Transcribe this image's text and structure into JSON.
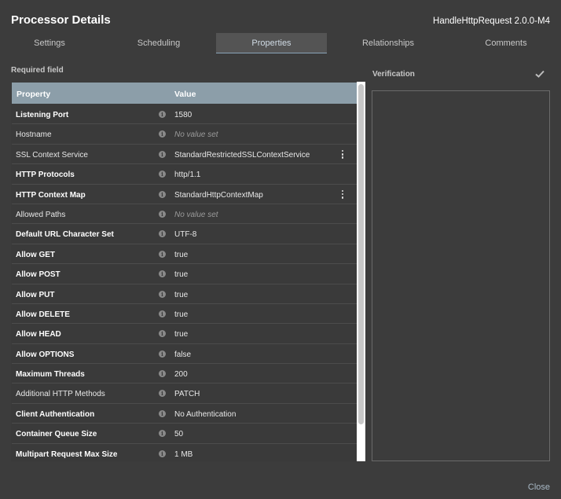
{
  "dialog": {
    "title": "Processor Details",
    "component_name": "HandleHttpRequest 2.0.0-M4",
    "close_label": "Close"
  },
  "tabs": [
    {
      "label": "Settings",
      "active": false
    },
    {
      "label": "Scheduling",
      "active": false
    },
    {
      "label": "Properties",
      "active": true
    },
    {
      "label": "Relationships",
      "active": false
    },
    {
      "label": "Comments",
      "active": false
    }
  ],
  "properties": {
    "required_label": "Required field",
    "header": {
      "property": "Property",
      "value": "Value"
    },
    "rows": [
      {
        "name": "Listening Port",
        "value": "1580",
        "required": true,
        "empty": false,
        "menu": false
      },
      {
        "name": "Hostname",
        "value": "No value set",
        "required": false,
        "empty": true,
        "menu": false
      },
      {
        "name": "SSL Context Service",
        "value": "StandardRestrictedSSLContextService",
        "required": false,
        "empty": false,
        "menu": true
      },
      {
        "name": "HTTP Protocols",
        "value": "http/1.1",
        "required": true,
        "empty": false,
        "menu": false
      },
      {
        "name": "HTTP Context Map",
        "value": "StandardHttpContextMap",
        "required": true,
        "empty": false,
        "menu": true
      },
      {
        "name": "Allowed Paths",
        "value": "No value set",
        "required": false,
        "empty": true,
        "menu": false
      },
      {
        "name": "Default URL Character Set",
        "value": "UTF-8",
        "required": true,
        "empty": false,
        "menu": false
      },
      {
        "name": "Allow GET",
        "value": "true",
        "required": true,
        "empty": false,
        "menu": false
      },
      {
        "name": "Allow POST",
        "value": "true",
        "required": true,
        "empty": false,
        "menu": false
      },
      {
        "name": "Allow PUT",
        "value": "true",
        "required": true,
        "empty": false,
        "menu": false
      },
      {
        "name": "Allow DELETE",
        "value": "true",
        "required": true,
        "empty": false,
        "menu": false
      },
      {
        "name": "Allow HEAD",
        "value": "true",
        "required": true,
        "empty": false,
        "menu": false
      },
      {
        "name": "Allow OPTIONS",
        "value": "false",
        "required": true,
        "empty": false,
        "menu": false
      },
      {
        "name": "Maximum Threads",
        "value": "200",
        "required": true,
        "empty": false,
        "menu": false
      },
      {
        "name": "Additional HTTP Methods",
        "value": "PATCH",
        "required": false,
        "empty": false,
        "menu": false
      },
      {
        "name": "Client Authentication",
        "value": "No Authentication",
        "required": true,
        "empty": false,
        "menu": false
      },
      {
        "name": "Container Queue Size",
        "value": "50",
        "required": true,
        "empty": false,
        "menu": false
      },
      {
        "name": "Multipart Request Max Size",
        "value": "1 MB",
        "required": true,
        "empty": false,
        "menu": false
      }
    ]
  },
  "verification": {
    "label": "Verification",
    "status_icon": "check-icon"
  },
  "colors": {
    "background": "#3c3c3c",
    "header": "#8c9ea9",
    "active_tab": "#545454",
    "link": "#a9b9c6"
  }
}
